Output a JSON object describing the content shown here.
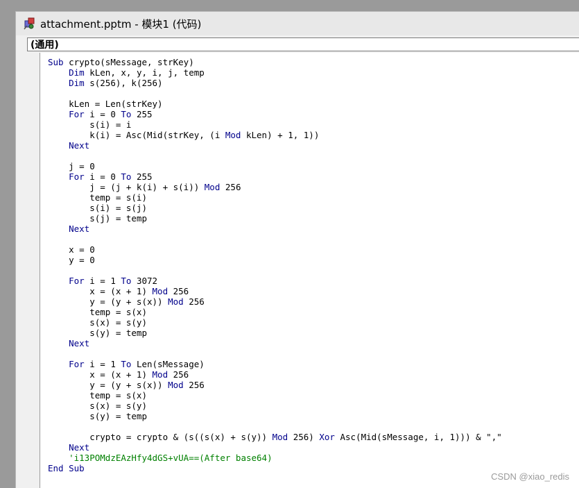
{
  "window": {
    "title": "attachment.pptm - 模块1 (代码)",
    "procedure_dropdown": "(通用)"
  },
  "code_lines": [
    [
      {
        "t": "Sub ",
        "k": 1
      },
      {
        "t": "crypto(sMessage, strKey)"
      }
    ],
    [
      {
        "t": "    "
      },
      {
        "t": "Dim ",
        "k": 1
      },
      {
        "t": "kLen, x, y, i, j, temp"
      }
    ],
    [
      {
        "t": "    "
      },
      {
        "t": "Dim ",
        "k": 1
      },
      {
        "t": "s(256), k(256)"
      }
    ],
    [],
    [
      {
        "t": "    kLen = Len(strKey)"
      }
    ],
    [
      {
        "t": "    "
      },
      {
        "t": "For ",
        "k": 1
      },
      {
        "t": "i = 0 "
      },
      {
        "t": "To ",
        "k": 1
      },
      {
        "t": "255"
      }
    ],
    [
      {
        "t": "        s(i) = i"
      }
    ],
    [
      {
        "t": "        k(i) = Asc(Mid(strKey, (i "
      },
      {
        "t": "Mod ",
        "k": 1
      },
      {
        "t": "kLen) + 1, 1))"
      }
    ],
    [
      {
        "t": "    "
      },
      {
        "t": "Next",
        "k": 1
      }
    ],
    [],
    [
      {
        "t": "    j = 0"
      }
    ],
    [
      {
        "t": "    "
      },
      {
        "t": "For ",
        "k": 1
      },
      {
        "t": "i = 0 "
      },
      {
        "t": "To ",
        "k": 1
      },
      {
        "t": "255"
      }
    ],
    [
      {
        "t": "        j = (j + k(i) + s(i)) "
      },
      {
        "t": "Mod ",
        "k": 1
      },
      {
        "t": "256"
      }
    ],
    [
      {
        "t": "        temp = s(i)"
      }
    ],
    [
      {
        "t": "        s(i) = s(j)"
      }
    ],
    [
      {
        "t": "        s(j) = temp"
      }
    ],
    [
      {
        "t": "    "
      },
      {
        "t": "Next",
        "k": 1
      }
    ],
    [],
    [
      {
        "t": "    x = 0"
      }
    ],
    [
      {
        "t": "    y = 0"
      }
    ],
    [],
    [
      {
        "t": "    "
      },
      {
        "t": "For ",
        "k": 1
      },
      {
        "t": "i = 1 "
      },
      {
        "t": "To ",
        "k": 1
      },
      {
        "t": "3072"
      }
    ],
    [
      {
        "t": "        x = (x + 1) "
      },
      {
        "t": "Mod ",
        "k": 1
      },
      {
        "t": "256"
      }
    ],
    [
      {
        "t": "        y = (y + s(x)) "
      },
      {
        "t": "Mod ",
        "k": 1
      },
      {
        "t": "256"
      }
    ],
    [
      {
        "t": "        temp = s(x)"
      }
    ],
    [
      {
        "t": "        s(x) = s(y)"
      }
    ],
    [
      {
        "t": "        s(y) = temp"
      }
    ],
    [
      {
        "t": "    "
      },
      {
        "t": "Next",
        "k": 1
      }
    ],
    [],
    [
      {
        "t": "    "
      },
      {
        "t": "For ",
        "k": 1
      },
      {
        "t": "i = 1 "
      },
      {
        "t": "To ",
        "k": 1
      },
      {
        "t": "Len(sMessage)"
      }
    ],
    [
      {
        "t": "        x = (x + 1) "
      },
      {
        "t": "Mod ",
        "k": 1
      },
      {
        "t": "256"
      }
    ],
    [
      {
        "t": "        y = (y + s(x)) "
      },
      {
        "t": "Mod ",
        "k": 1
      },
      {
        "t": "256"
      }
    ],
    [
      {
        "t": "        temp = s(x)"
      }
    ],
    [
      {
        "t": "        s(x) = s(y)"
      }
    ],
    [
      {
        "t": "        s(y) = temp"
      }
    ],
    [],
    [
      {
        "t": "        crypto = crypto & (s((s(x) + s(y)) "
      },
      {
        "t": "Mod ",
        "k": 1
      },
      {
        "t": "256) "
      },
      {
        "t": "Xor ",
        "k": 1
      },
      {
        "t": "Asc(Mid(sMessage, i, 1))) & \",\""
      }
    ],
    [
      {
        "t": "    "
      },
      {
        "t": "Next",
        "k": 1
      }
    ],
    [
      {
        "t": "    "
      },
      {
        "t": "'i13POMdzEAzHfy4dGS+vUA==(After base64)",
        "c": 1
      }
    ],
    [
      {
        "t": "End Sub",
        "k": 1
      }
    ]
  ],
  "watermark": "CSDN @xiao_redis",
  "colors": {
    "keyword": "#00008b",
    "comment": "#008000",
    "text": "#000000"
  },
  "icons": {
    "app": "vba-editor-icon"
  }
}
